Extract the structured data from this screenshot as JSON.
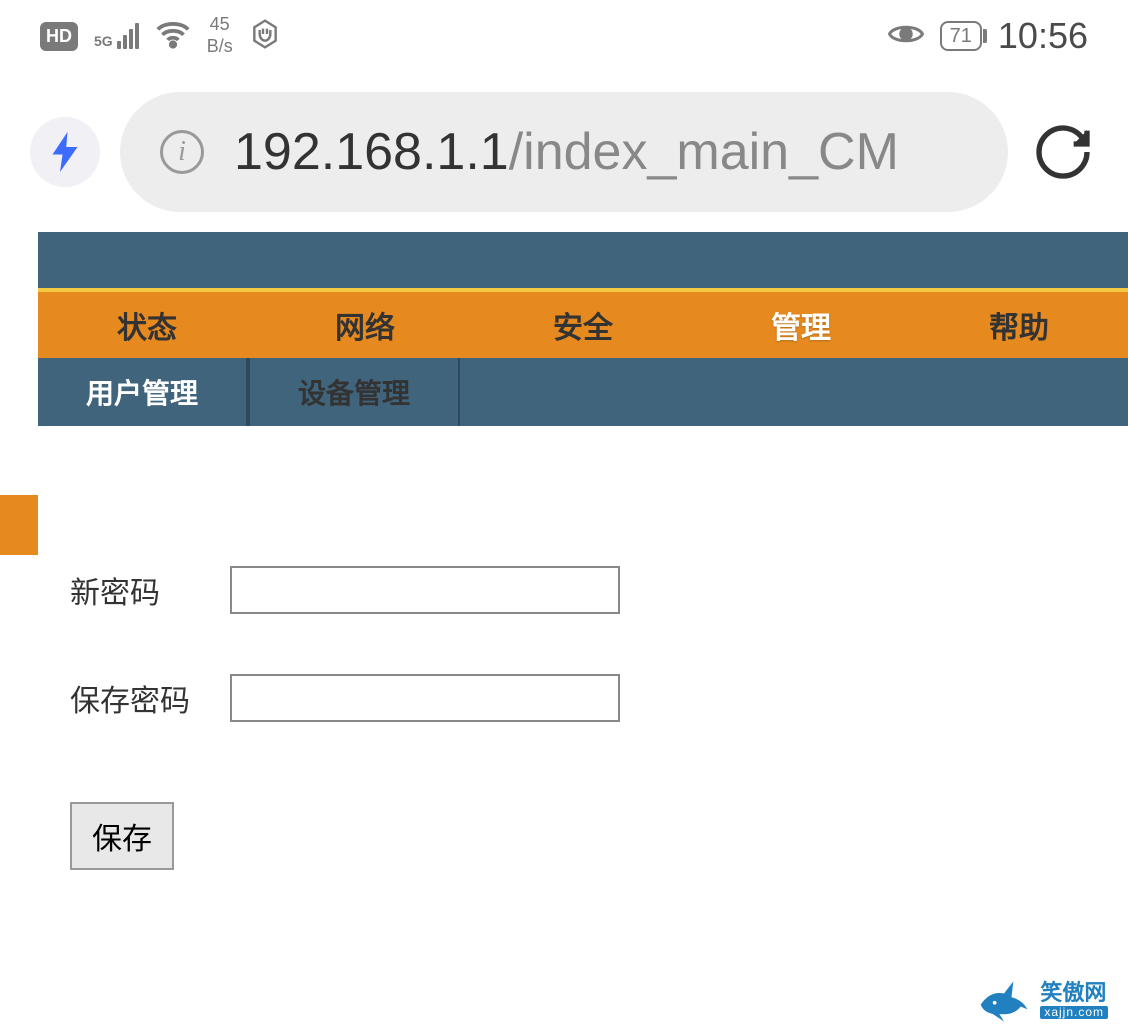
{
  "status_bar": {
    "hd_label": "HD",
    "signal_type": "5G",
    "speed_value": "45",
    "speed_unit": "B/s",
    "battery_percent": "71",
    "time": "10:56"
  },
  "browser": {
    "url_host": "192.168.1.1",
    "url_path": "/index_main_CM"
  },
  "main_nav": {
    "items": [
      {
        "label": "状态",
        "active": false
      },
      {
        "label": "网络",
        "active": false
      },
      {
        "label": "安全",
        "active": false
      },
      {
        "label": "管理",
        "active": true
      },
      {
        "label": "帮助",
        "active": false
      }
    ]
  },
  "sub_nav": {
    "items": [
      {
        "label": "用户管理",
        "active": true
      },
      {
        "label": "设备管理",
        "active": false
      }
    ]
  },
  "form": {
    "new_password_label": "新密码",
    "confirm_password_label": "保存密码",
    "new_password_value": "",
    "confirm_password_value": "",
    "save_button_label": "保存"
  },
  "watermark": {
    "cn": "笑傲网",
    "en": "xajjn.com"
  },
  "colors": {
    "nav_bg": "#e68a1f",
    "header_bg": "#41647d",
    "accent_yellow": "#f5c842"
  }
}
